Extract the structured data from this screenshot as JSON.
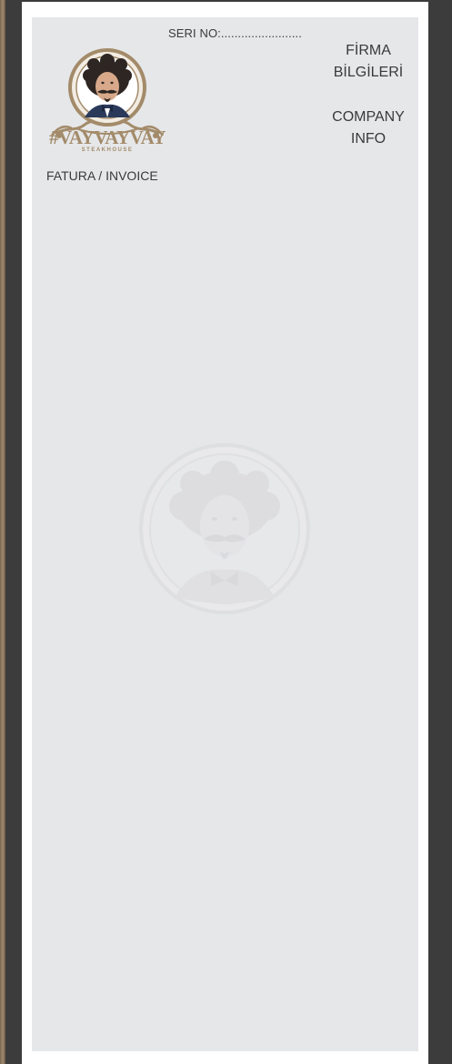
{
  "document": {
    "serial_label": "SERI NO:........................",
    "company_info_tr_line1": "FİRMA",
    "company_info_tr_line2": "BİLGİLERİ",
    "company_info_en_line1": "COMPANY",
    "company_info_en_line2": "INFO",
    "invoice_title": "FATURA / INVOICE"
  },
  "logo": {
    "brand_name": "#VAYVAYVAY",
    "brand_subtitle": "STEAKHOUSE",
    "icon": "mustached-man-portrait-icon"
  },
  "watermark": {
    "icon": "mustached-man-portrait-watermark"
  },
  "colors": {
    "background": "#3c3c3c",
    "paper": "#ffffff",
    "sheet": "#e6e7e9",
    "brand_gold": "#a38b6a",
    "text": "#3a3a3a"
  }
}
